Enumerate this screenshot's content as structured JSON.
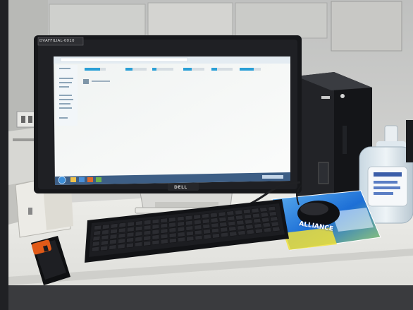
{
  "photo": {
    "subject": "desktop-workstation",
    "monitor_asset_tag": "DVAFFILIAL-0010",
    "monitor_brand": "DELL",
    "mousepad_text": "ALLIANCE"
  },
  "screen": {
    "window": "file-explorer",
    "content": "mostly-blank"
  },
  "colors": {
    "wall": "#d9d9d6",
    "desk": "#e7e7e3",
    "monitor_bezel": "#16171a",
    "screen": "#f5f7f6",
    "taskbar": "#3d5e85",
    "tower": "#1b1c1f",
    "mousepad_blue": "#1d6fd6",
    "stapler": "#e05a18"
  }
}
